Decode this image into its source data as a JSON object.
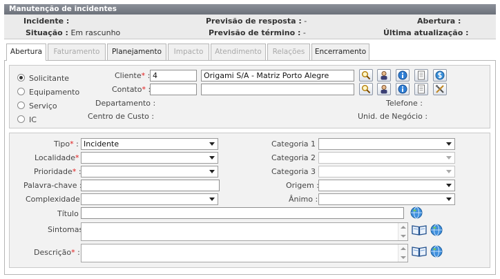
{
  "window": {
    "title": "Manutenção de incidentes"
  },
  "info": {
    "incidente_label": "Incidente :",
    "previsao_resposta_label": "Previsão de resposta :",
    "previsao_resposta_value": "-",
    "abertura_label": "Abertura :",
    "situacao_label": "Situação :",
    "situacao_value": "Em rascunho",
    "previsao_termino_label": "Previsão de término :",
    "previsao_termino_value": "-",
    "ultima_atualizacao_label": "Última atualização :"
  },
  "tabs": [
    {
      "label": "Abertura"
    },
    {
      "label": "Faturamento"
    },
    {
      "label": "Planejamento"
    },
    {
      "label": "Impacto"
    },
    {
      "label": "Atendimento"
    },
    {
      "label": "Relações"
    },
    {
      "label": "Encerramento"
    }
  ],
  "requester": {
    "radios": [
      {
        "label": "Solicitante",
        "selected": true
      },
      {
        "label": "Equipamento",
        "selected": false
      },
      {
        "label": "Serviço",
        "selected": false
      },
      {
        "label": "IC",
        "selected": false
      }
    ],
    "cliente_label": "Cliente",
    "cliente_code": "4",
    "cliente_name": "Origami S/A - Matriz Porto Alegre",
    "contato_label": "Contato",
    "contato_code": "",
    "contato_name": "",
    "departamento_label": "Departamento :",
    "centro_custo_label": "Centro de Custo :",
    "telefone_label": "Telefone :",
    "unid_negocio_label": "Unid. de Negócio :",
    "required_mark": "*",
    "colon": ":"
  },
  "details": {
    "tipo_label": "Tipo",
    "tipo_value": "Incidente",
    "localidade_label": "Localidade",
    "localidade_value": "",
    "prioridade_label": "Prioridade",
    "prioridade_value": "",
    "palavra_chave_label": "Palavra-chave :",
    "palavra_chave_value": "",
    "complexidade_label": "Complexidade :",
    "complexidade_value": "",
    "categoria1_label": "Categoria 1 :",
    "categoria2_label": "Categoria 2 :",
    "categoria3_label": "Categoria 3 :",
    "origem_label": "Origem :",
    "animo_label": "Ânimo :",
    "titulo_label": "Título :",
    "titulo_value": "",
    "sintomas_label": "Sintomas :",
    "descricao_label": "Descrição"
  },
  "icons": {
    "search": "search-icon",
    "person": "person-icon",
    "info": "info-icon",
    "document": "document-icon",
    "money": "money-icon",
    "tools": "tools-icon",
    "globe": "globe-icon",
    "book": "book-icon"
  },
  "colors": {
    "title_bar": "#7a7f88",
    "info_bg": "#ebebeb",
    "group_bg": "#f2f2f2",
    "required": "#e01b1b"
  }
}
